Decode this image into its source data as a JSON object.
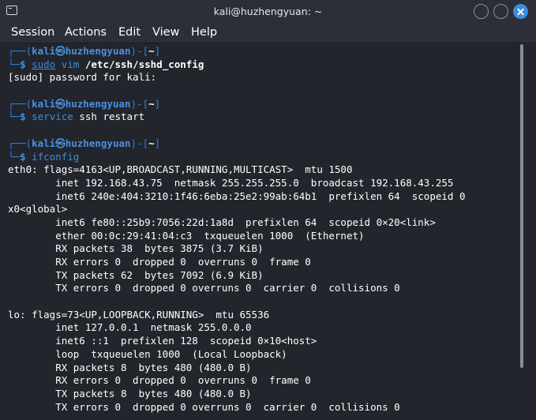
{
  "window": {
    "title": "kali@huzhengyuan: ~"
  },
  "menu": [
    "Session",
    "Actions",
    "Edit",
    "View",
    "Help"
  ],
  "prompt": {
    "user": "kali",
    "at_glyph": "㉿",
    "host": "huzhengyuan",
    "dir": "~"
  },
  "commands": [
    {
      "name": "sudo",
      "rest": " vim ",
      "arg": "/etc/ssh/sshd_config",
      "output": [
        "[sudo] password for kali:"
      ]
    },
    {
      "name": "service",
      "rest": " ssh restart",
      "arg": "",
      "output": []
    },
    {
      "name": "ifconfig",
      "rest": "",
      "arg": "",
      "output": [
        "eth0: flags=4163<UP,BROADCAST,RUNNING,MULTICAST>  mtu 1500",
        "        inet 192.168.43.75  netmask 255.255.255.0  broadcast 192.168.43.255",
        "        inet6 240e:404:3210:1f46:6eba:25e2:99ab:64b1  prefixlen 64  scopeid 0",
        "x0<global>",
        "        inet6 fe80::25b9:7056:22d:1a8d  prefixlen 64  scopeid 0×20<link>",
        "        ether 00:0c:29:41:04:c3  txqueuelen 1000  (Ethernet)",
        "        RX packets 38  bytes 3875 (3.7 KiB)",
        "        RX errors 0  dropped 0  overruns 0  frame 0",
        "        TX packets 62  bytes 7092 (6.9 KiB)",
        "        TX errors 0  dropped 0 overruns 0  carrier 0  collisions 0",
        "",
        "lo: flags=73<UP,LOOPBACK,RUNNING>  mtu 65536",
        "        inet 127.0.0.1  netmask 255.0.0.0",
        "        inet6 ::1  prefixlen 128  scopeid 0×10<host>",
        "        loop  txqueuelen 1000  (Local Loopback)",
        "        RX packets 8  bytes 480 (480.0 B)",
        "        RX errors 0  dropped 0  overruns 0  frame 0",
        "        TX packets 8  bytes 480 (480.0 B)",
        "        TX errors 0  dropped 0 overruns 0  carrier 0  collisions 0"
      ]
    }
  ],
  "colors": {
    "background": "#22252b",
    "titlebar": "#2c2f37",
    "prompt_blue": "#2f7fe8",
    "command_blue": "#3b8de0",
    "text": "#ffffff"
  }
}
